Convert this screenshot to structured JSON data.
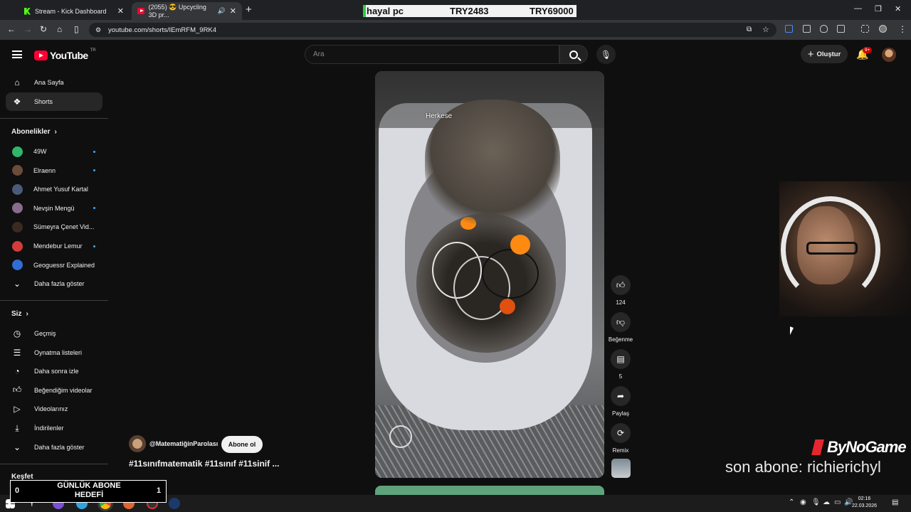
{
  "browser": {
    "tabs": [
      {
        "title": "Stream - Kick Dashboard"
      },
      {
        "title": "(2055) 😎 Upcycling 3D pr..."
      }
    ],
    "url": "youtube.com/shorts/IEmRFM_9RK4",
    "ticker": {
      "name": "hayal pc",
      "value1": "TRY2483",
      "value2": "TRY69000"
    }
  },
  "youtube": {
    "logo_text": "YouTube",
    "logo_region": "TR",
    "search_placeholder": "Ara",
    "create_label": "Oluştur",
    "notif_badge": "9+"
  },
  "sidebar": {
    "main": [
      {
        "label": "Ana Sayfa",
        "icon": "home-icon"
      },
      {
        "label": "Shorts",
        "icon": "shorts-icon"
      }
    ],
    "subscriptions_title": "Abonelikler",
    "subscriptions": [
      {
        "label": "49W",
        "color": "#2fb66a",
        "dot": true
      },
      {
        "label": "Elraenn",
        "color": "#6b4c3b",
        "dot": true
      },
      {
        "label": "Ahmet Yusuf Kartal",
        "color": "#4a5a7a",
        "dot": false
      },
      {
        "label": "Nevşin Mengü",
        "color": "#8a6b8b",
        "dot": true
      },
      {
        "label": "Sümeyra Çenet Vid...",
        "color": "#3b2a22",
        "dot": false
      },
      {
        "label": "Mendebur Lemur",
        "color": "#d43b3b",
        "dot": true
      },
      {
        "label": "Geoguessr Explained",
        "color": "#2f6ed4",
        "dot": false
      }
    ],
    "show_more_1": "Daha fazla göster",
    "you_title": "Siz",
    "you": [
      {
        "label": "Geçmiş",
        "icon": "history-icon"
      },
      {
        "label": "Oynatma listeleri",
        "icon": "playlists-icon"
      },
      {
        "label": "Daha sonra izle",
        "icon": "watch-later-icon"
      },
      {
        "label": "Beğendiğim videolar",
        "icon": "liked-icon"
      },
      {
        "label": "Videolarınız",
        "icon": "your-videos-icon"
      },
      {
        "label": "İndirilenler",
        "icon": "downloads-icon"
      }
    ],
    "show_more_2": "Daha fazla göster",
    "explore_title": "Keşfet"
  },
  "short": {
    "overlay_text": "Herkese",
    "channel": "@MatematiğinParolası",
    "subscribe": "Abone ol",
    "hashtags": "#11sınıfmatematik #11sınıf #11sinif ...",
    "likes": "124",
    "dislike_label": "Beğenme",
    "comments": "5",
    "share_label": "Paylaş",
    "remix_label": "Remix"
  },
  "overlays": {
    "brand": "ByNoGame",
    "last_sub": "son abone: richierichyl",
    "daily_goal_title": "GÜNLÜK ABONE HEDEFİ",
    "daily_goal_current": "0",
    "daily_goal_target": "1"
  },
  "taskbar": {
    "time": "02:16",
    "date": "22.03.2026"
  }
}
